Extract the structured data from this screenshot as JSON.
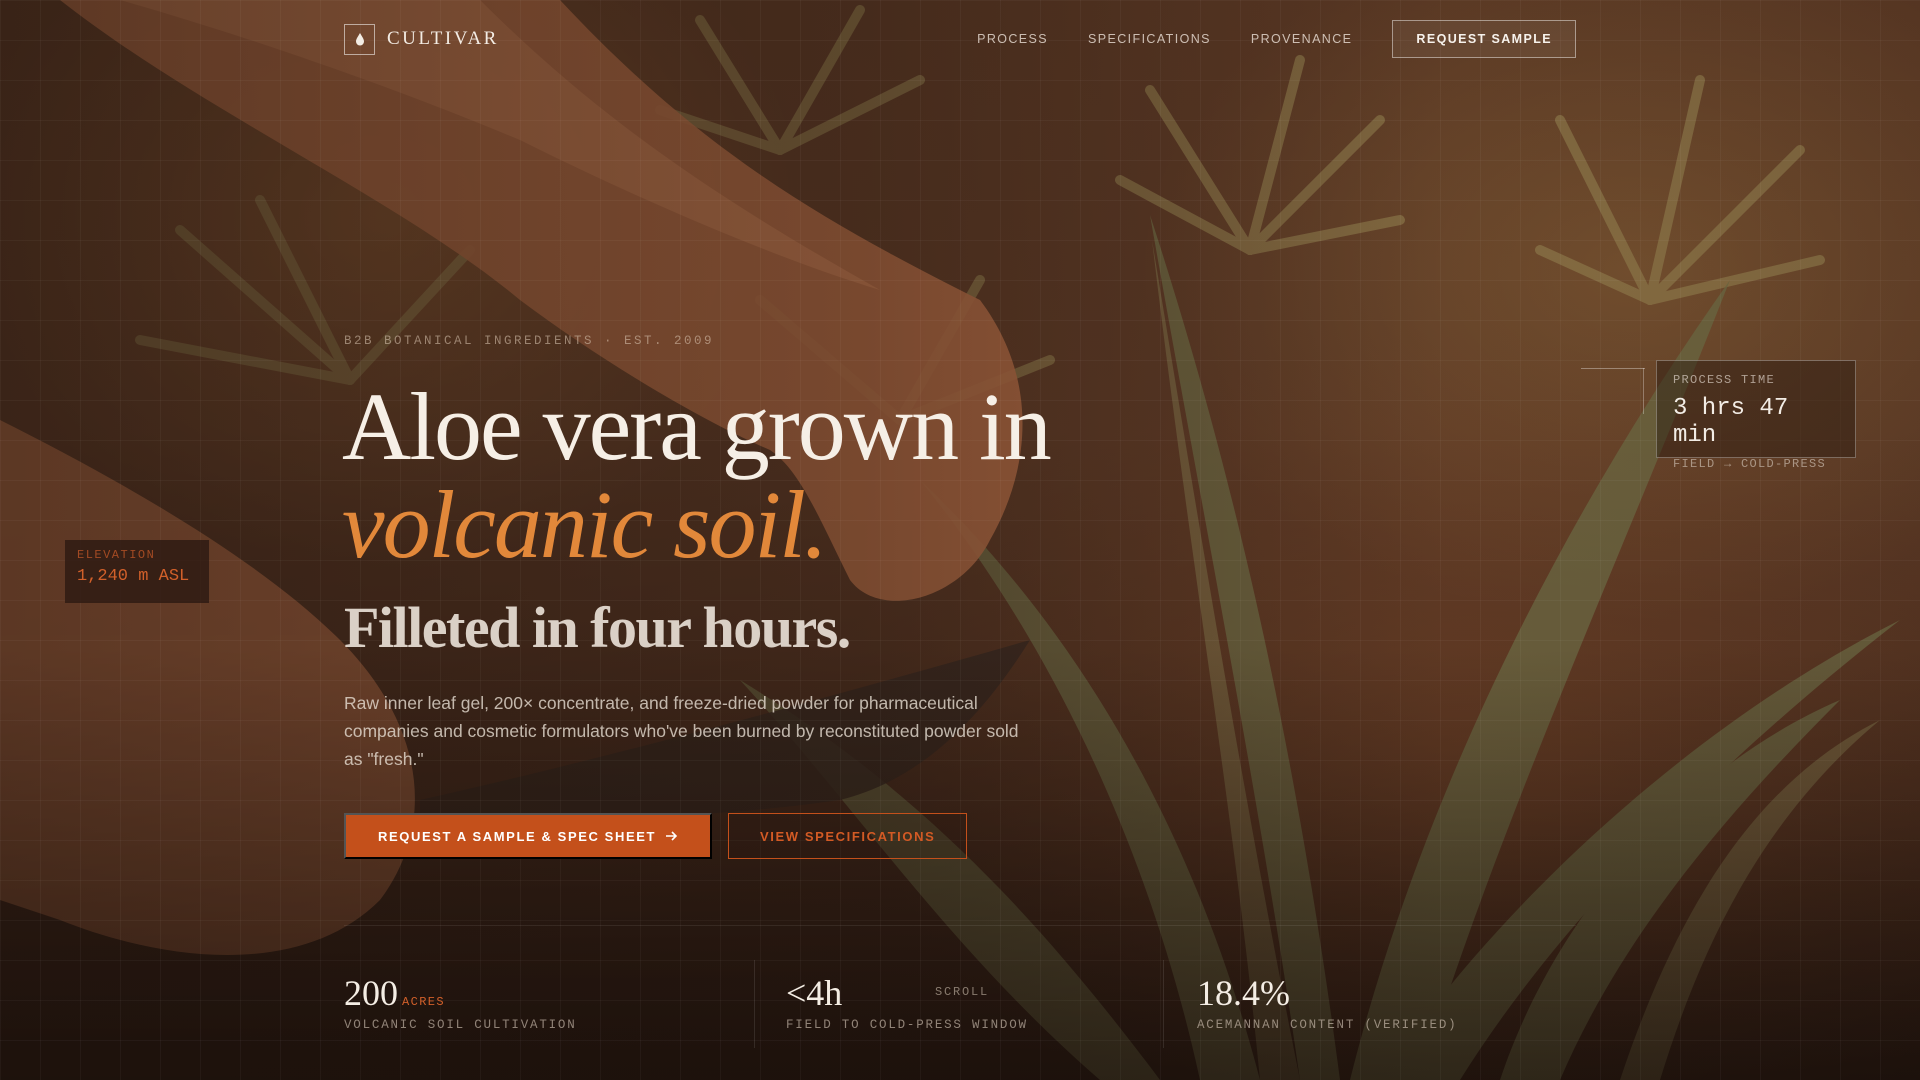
{
  "brand": {
    "name": "CULTIVAR",
    "mark_icon": "drop-icon"
  },
  "nav": {
    "links": [
      "PROCESS",
      "SPECIFICATIONS",
      "PROVENANCE"
    ],
    "cta": "REQUEST SAMPLE"
  },
  "hero": {
    "eyebrow": "B2B BOTANICAL INGREDIENTS · EST. 2009",
    "headline_line1": "Aloe vera grown in",
    "headline_line2": "volcanic soil.",
    "subhead": "Filleted in four hours.",
    "description": "Raw inner leaf gel, 200× concentrate, and freeze-dried powder for pharmaceutical companies and cosmetic formulators who've been burned by reconstituted powder sold as \"fresh.\"",
    "primary_cta": "REQUEST A SAMPLE & SPEC SHEET",
    "primary_cta_icon": "arrow-right-icon",
    "secondary_cta": "VIEW SPECIFICATIONS"
  },
  "elevation_tag": {
    "label": "ELEVATION",
    "value": "1,240 m ASL"
  },
  "process_tag": {
    "label": "PROCESS TIME",
    "value": "3 hrs 47 min",
    "sub": "FIELD → COLD-PRESS"
  },
  "stats": [
    {
      "value": "200",
      "unit": "ACRES",
      "label": "VOLCANIC SOIL CULTIVATION"
    },
    {
      "value": "<4h",
      "unit": "",
      "label": "FIELD TO COLD-PRESS WINDOW"
    },
    {
      "value": "18.4%",
      "unit": "",
      "label": "ACEMANNAN CONTENT (VERIFIED)"
    }
  ],
  "scroll_hint": "SCROLL",
  "colors": {
    "accent": "#c4501b",
    "accent_text": "#e2883a",
    "text": "#f6efe6"
  }
}
